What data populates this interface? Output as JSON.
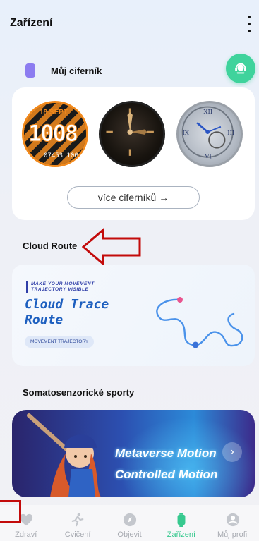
{
  "header": {
    "title": "Zařízení"
  },
  "watchfaces": {
    "title": "Můj ciferník",
    "more_button": "více ciferníků",
    "more_arrow": "→",
    "face1": {
      "date_day": "18",
      "date_month": "SEPT",
      "time": "1008",
      "bottom": "07453 100"
    }
  },
  "cloud": {
    "section_title": "Cloud Route",
    "banner_small_line1": "MAKE YOUR MOVEMENT",
    "banner_small_line2": "TRAJECTORY VISIBLE",
    "banner_title_line1": "Cloud Trace",
    "banner_title_line2": "Route",
    "banner_pill": "MOVEMENT TRAJECTORY"
  },
  "somato": {
    "section_title": "Somatosenzorické sporty",
    "banner_line1": "Metaverse Motion",
    "banner_line2": "Controlled Motion",
    "next_glyph": "›"
  },
  "nav": {
    "items": [
      {
        "label": "Zdraví",
        "icon": "heart-icon"
      },
      {
        "label": "Cvičení",
        "icon": "running-icon"
      },
      {
        "label": "Objevit",
        "icon": "compass-icon"
      },
      {
        "label": "Zařízení",
        "icon": "watch-icon"
      },
      {
        "label": "Můj profil",
        "icon": "profile-icon"
      }
    ],
    "active_index": 3
  },
  "colors": {
    "accent": "#37c98f",
    "fab": "#3fd39c",
    "annotation": "#c30b0b"
  }
}
